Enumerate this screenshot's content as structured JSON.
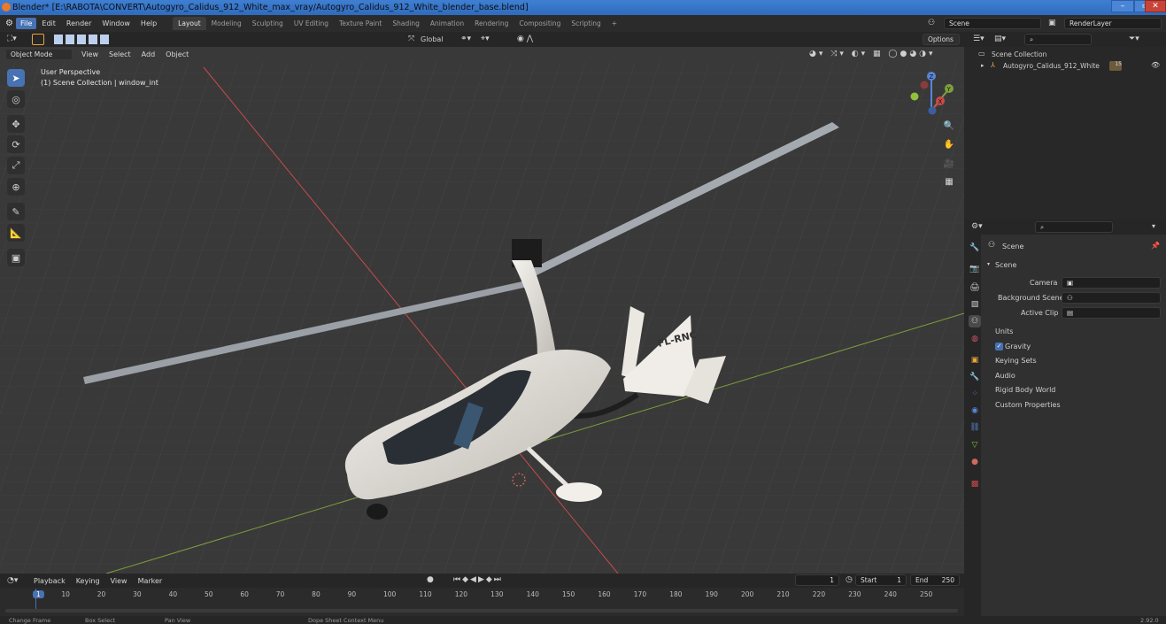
{
  "window": {
    "title": "Blender* [E:\\RABOTA\\CONVERT\\Autogyro_Calidus_912_White_max_vray/Autogyro_Calidus_912_White_blender_base.blend]"
  },
  "menus": [
    "File",
    "Edit",
    "Render",
    "Window",
    "Help"
  ],
  "workspaces": [
    "Layout",
    "Modeling",
    "Sculpting",
    "UV Editing",
    "Texture Paint",
    "Shading",
    "Animation",
    "Rendering",
    "Compositing",
    "Scripting"
  ],
  "top_right": {
    "scene": "Scene",
    "render_layer": "RenderLayer"
  },
  "viewport_header": {
    "transform_orientation": "Global",
    "options": "Options"
  },
  "object_mode_bar": {
    "mode": "Object Mode",
    "view": "View",
    "select": "Select",
    "add": "Add",
    "object": "Object"
  },
  "viewport_info": {
    "perspective": "User Perspective",
    "collection": "(1) Scene Collection | window_int"
  },
  "model": {
    "registration": "FL-RNC"
  },
  "gizmo_axes": {
    "x": "X",
    "y": "Y",
    "z": "Z"
  },
  "outliner": {
    "root": "Scene Collection",
    "object": "Autogyro_Calidus_912_White",
    "badge": "15"
  },
  "properties": {
    "tab_title": "Scene",
    "section": "Scene",
    "camera_label": "Camera",
    "background_label": "Background Scene",
    "active_clip_label": "Active Clip",
    "panels": [
      "Units",
      "Gravity",
      "Keying Sets",
      "Audio",
      "Rigid Body World",
      "Custom Properties"
    ],
    "gravity_checked": true
  },
  "timeline": {
    "playback": "Playback",
    "keying": "Keying",
    "view": "View",
    "marker": "Marker",
    "current_frame": "1",
    "start_label": "Start",
    "start": "1",
    "end_label": "End",
    "end": "250",
    "ticks": [
      "1",
      "10",
      "20",
      "30",
      "40",
      "50",
      "60",
      "70",
      "80",
      "90",
      "100",
      "110",
      "120",
      "130",
      "140",
      "150",
      "160",
      "170",
      "180",
      "190",
      "200",
      "210",
      "220",
      "230",
      "240",
      "250"
    ]
  },
  "statusbar": {
    "change_frame": "Change Frame",
    "box_select": "Box Select",
    "pan_view": "Pan View",
    "context_menu": "Dope Sheet Context Menu",
    "version": "2.92.0"
  },
  "colors": {
    "accent": "#4772b3",
    "x_axis": "#c94a4a",
    "y_axis": "#7ea03c",
    "titlebar": "#3f7fd2"
  }
}
